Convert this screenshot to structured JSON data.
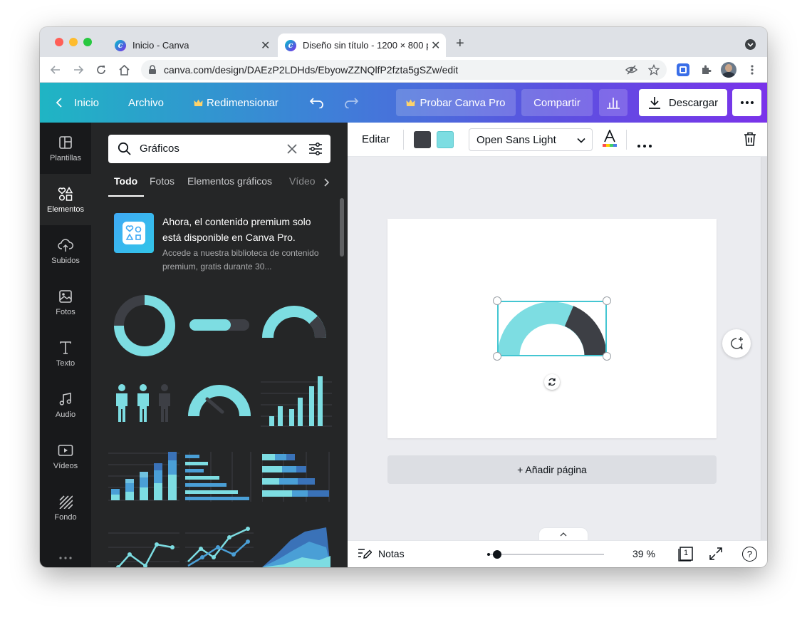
{
  "browser": {
    "tabs": [
      {
        "title": "Inicio - Canva"
      },
      {
        "title": "Diseño sin título - 1200 × 800 p"
      }
    ],
    "new_tab": "+",
    "url": "canva.com/design/DAEzP2LDHds/EbyowZZNQlfP2fzta5gSZw/edit"
  },
  "header": {
    "home": "Inicio",
    "file": "Archivo",
    "resize": "Redimensionar",
    "try_pro": "Probar Canva Pro",
    "share": "Compartir",
    "download": "Descargar"
  },
  "rail": [
    {
      "label": "Plantillas",
      "icon": "templates-icon"
    },
    {
      "label": "Elementos",
      "icon": "elements-icon"
    },
    {
      "label": "Subidos",
      "icon": "upload-icon"
    },
    {
      "label": "Fotos",
      "icon": "photos-icon"
    },
    {
      "label": "Texto",
      "icon": "text-icon"
    },
    {
      "label": "Audio",
      "icon": "audio-icon"
    },
    {
      "label": "Vídeos",
      "icon": "video-icon"
    },
    {
      "label": "Fondo",
      "icon": "background-icon"
    }
  ],
  "panel": {
    "search_value": "Gráficos",
    "categories": [
      "Todo",
      "Fotos",
      "Elementos gráficos",
      "Vídeo"
    ],
    "promo_title": "Ahora, el contenido premium solo está disponible en Canva Pro.",
    "promo_sub": "Accede a nuestra biblioteca de contenido premium, gratis durante 30..."
  },
  "toolbar": {
    "edit": "Editar",
    "font": "Open Sans Light",
    "color_dark": "#3d3f45",
    "color_teal": "#7ddde2"
  },
  "editor": {
    "add_page": "+ Añadir página"
  },
  "footer": {
    "notes": "Notas",
    "zoom": "39 %",
    "zoom_fraction": 0.05,
    "page_count": "1"
  },
  "colors": {
    "teal": "#7ddde2",
    "dark": "#3d3f45",
    "accent": "#7a33ea"
  }
}
